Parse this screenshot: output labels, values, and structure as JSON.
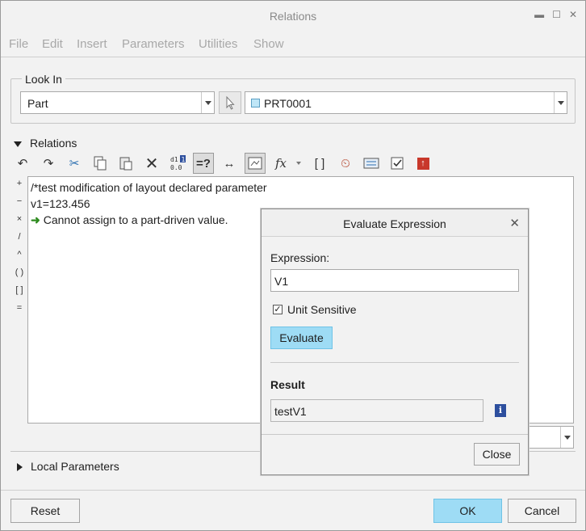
{
  "window": {
    "title": "Relations"
  },
  "menu": [
    "File",
    "Edit",
    "Insert",
    "Parameters",
    "Utilities",
    "Show"
  ],
  "look_in": {
    "label": "Look In",
    "type_value": "Part",
    "model_value": "PRT0001"
  },
  "relations": {
    "label": "Relations",
    "side_ops": [
      "+",
      "−",
      "×",
      "/",
      "^",
      "( )",
      "[ ]",
      "="
    ],
    "lines": [
      "/*test modification of layout declared parameter",
      "v1=123.456"
    ],
    "message": "Cannot assign to a part-driven value.",
    "fx_label": "fx"
  },
  "local_parameters": {
    "label": "Local Parameters"
  },
  "footer": {
    "reset": "Reset",
    "ok": "OK",
    "cancel": "Cancel"
  },
  "dialog": {
    "title": "Evaluate Expression",
    "expression_label": "Expression:",
    "expression_value": "V1",
    "unit_sensitive_label": "Unit Sensitive",
    "unit_sensitive_checked": true,
    "evaluate": "Evaluate",
    "result_label": "Result",
    "result_value": "testV1",
    "close": "Close"
  },
  "colors": {
    "accent": "#9edcf5",
    "message_arrow": "#2e8b1f",
    "info_icon": "#2d4f9e"
  }
}
